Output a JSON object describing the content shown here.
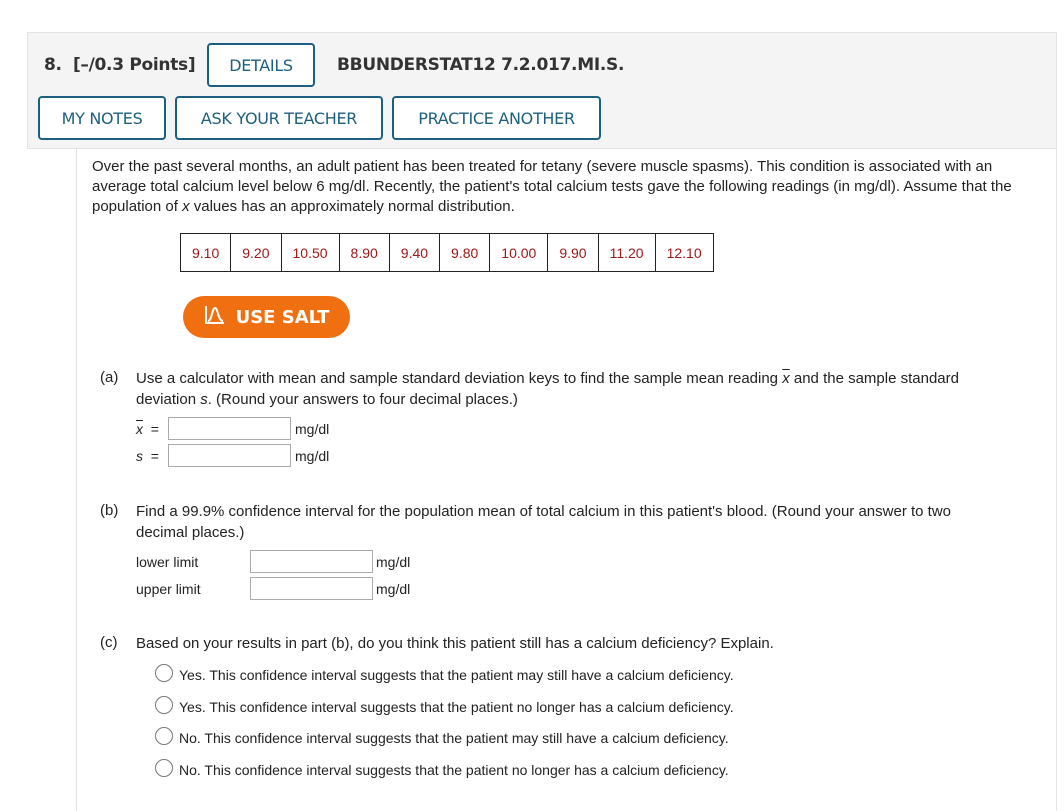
{
  "header": {
    "question_number": "8.",
    "points": "[–/0.3 Points]",
    "details_label": "DETAILS",
    "problem_code": "BBUNDERSTAT12 7.2.017.MI.S.",
    "my_notes_label": "MY NOTES",
    "ask_teacher_label": "ASK YOUR TEACHER",
    "practice_label": "PRACTICE ANOTHER"
  },
  "problem": {
    "intro_1": "Over the past several months, an adult patient has been treated for tetany (severe muscle spasms). This condition is associated with an average total calcium level below 6 mg/dl. Recently, the patient's total calcium tests gave the following readings (in mg/dl). Assume that the population of ",
    "intro_var": "x",
    "intro_2": " values has an approximately normal distribution.",
    "readings": [
      "9.10",
      "9.20",
      "10.50",
      "8.90",
      "9.40",
      "9.80",
      "10.00",
      "9.90",
      "11.20",
      "12.10"
    ],
    "salt_label": "USE SALT",
    "salt_icon": "bell-curve-icon",
    "accent_color": "#f07011",
    "value_color": "#a01818"
  },
  "part_a": {
    "letter": "(a)",
    "text_1": "Use a calculator with mean and sample standard deviation keys to find the sample mean reading ",
    "text_var1": "x",
    "text_2": " and the sample standard deviation ",
    "text_var2": "s",
    "text_3": ". (Round your answers to four decimal places.)",
    "mean_label": "x",
    "sd_label": "s",
    "equals": "=",
    "mean_value": "",
    "sd_value": "",
    "unit": "mg/dl"
  },
  "part_b": {
    "letter": "(b)",
    "text": "Find a 99.9% confidence interval for the population mean of total calcium in this patient's blood. (Round your answer to two decimal places.)",
    "lower_label": "lower limit",
    "upper_label": "upper limit",
    "lower_value": "",
    "upper_value": "",
    "unit": "mg/dl"
  },
  "part_c": {
    "letter": "(c)",
    "text": "Based on your results in part (b), do you think this patient still has a calcium deficiency? Explain.",
    "options": [
      "Yes. This confidence interval suggests that the patient may still have a calcium deficiency.",
      "Yes. This confidence interval suggests that the patient no longer has a calcium deficiency.",
      "No. This confidence interval suggests that the patient may still have a calcium deficiency.",
      "No. This confidence interval suggests that the patient no longer has a calcium deficiency."
    ]
  }
}
